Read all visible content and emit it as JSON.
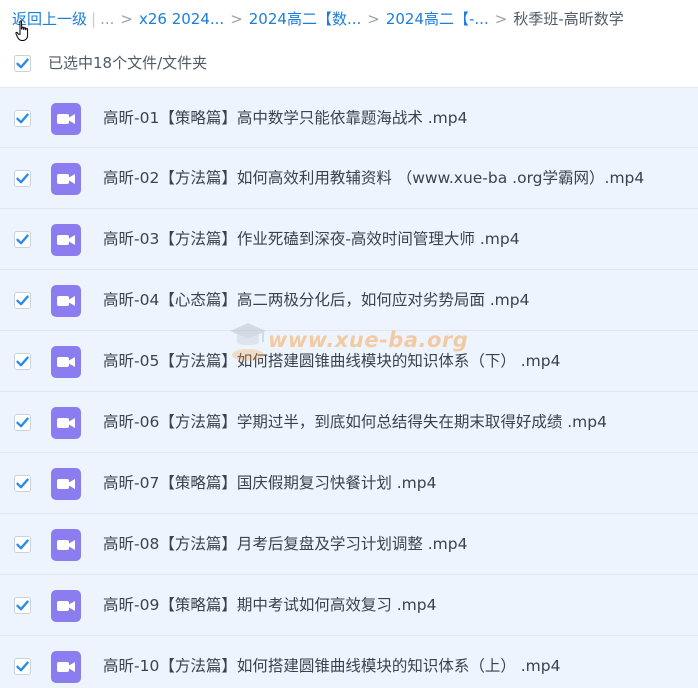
{
  "breadcrumb": {
    "back_label": "返回上一级",
    "pipe": "|",
    "ellipsis": "...",
    "separator": ">",
    "items": [
      {
        "label": "x26 2024..."
      },
      {
        "label": "2024高二【数..."
      },
      {
        "label": "2024高二【-..."
      }
    ],
    "current": "秋季班-高昕数学"
  },
  "selection": {
    "label": "已选中18个文件/文件夹",
    "checked": true
  },
  "files": [
    {
      "name": "高昕-01【策略篇】高中数学只能依靠题海战术 .mp4",
      "checked": true,
      "icon": "video-file-icon"
    },
    {
      "name": "高昕-02【方法篇】如何高效利用教辅资料 （www.xue-ba .org学霸网）.mp4",
      "checked": true,
      "icon": "video-file-icon"
    },
    {
      "name": "高昕-03【方法篇】作业死磕到深夜-高效时间管理大师 .mp4",
      "checked": true,
      "icon": "video-file-icon"
    },
    {
      "name": "高昕-04【心态篇】高二两极分化后，如何应对劣势局面 .mp4",
      "checked": true,
      "icon": "video-file-icon"
    },
    {
      "name": "高昕-05【方法篇】如何搭建圆锥曲线模块的知识体系（下） .mp4",
      "checked": true,
      "icon": "video-file-icon"
    },
    {
      "name": "高昕-06【方法篇】学期过半，到底如何总结得失在期末取得好成绩 .mp4",
      "checked": true,
      "icon": "video-file-icon"
    },
    {
      "name": "高昕-07【策略篇】国庆假期复习快餐计划 .mp4",
      "checked": true,
      "icon": "video-file-icon"
    },
    {
      "name": "高昕-08【方法篇】月考后复盘及学习计划调整 .mp4",
      "checked": true,
      "icon": "video-file-icon"
    },
    {
      "name": "高昕-09【策略篇】期中考试如何高效复习 .mp4",
      "checked": true,
      "icon": "video-file-icon"
    },
    {
      "name": "高昕-10【方法篇】如何搭建圆锥曲线模块的知识体系（上） .mp4",
      "checked": true,
      "icon": "video-file-icon"
    }
  ],
  "watermark": {
    "text": "www.xue-ba.org"
  },
  "colors": {
    "link": "#1a7edc",
    "checkbox": "#2a8ce8",
    "row_selected_bg": "#eef4fd",
    "video_icon": "#8b7cf0"
  }
}
